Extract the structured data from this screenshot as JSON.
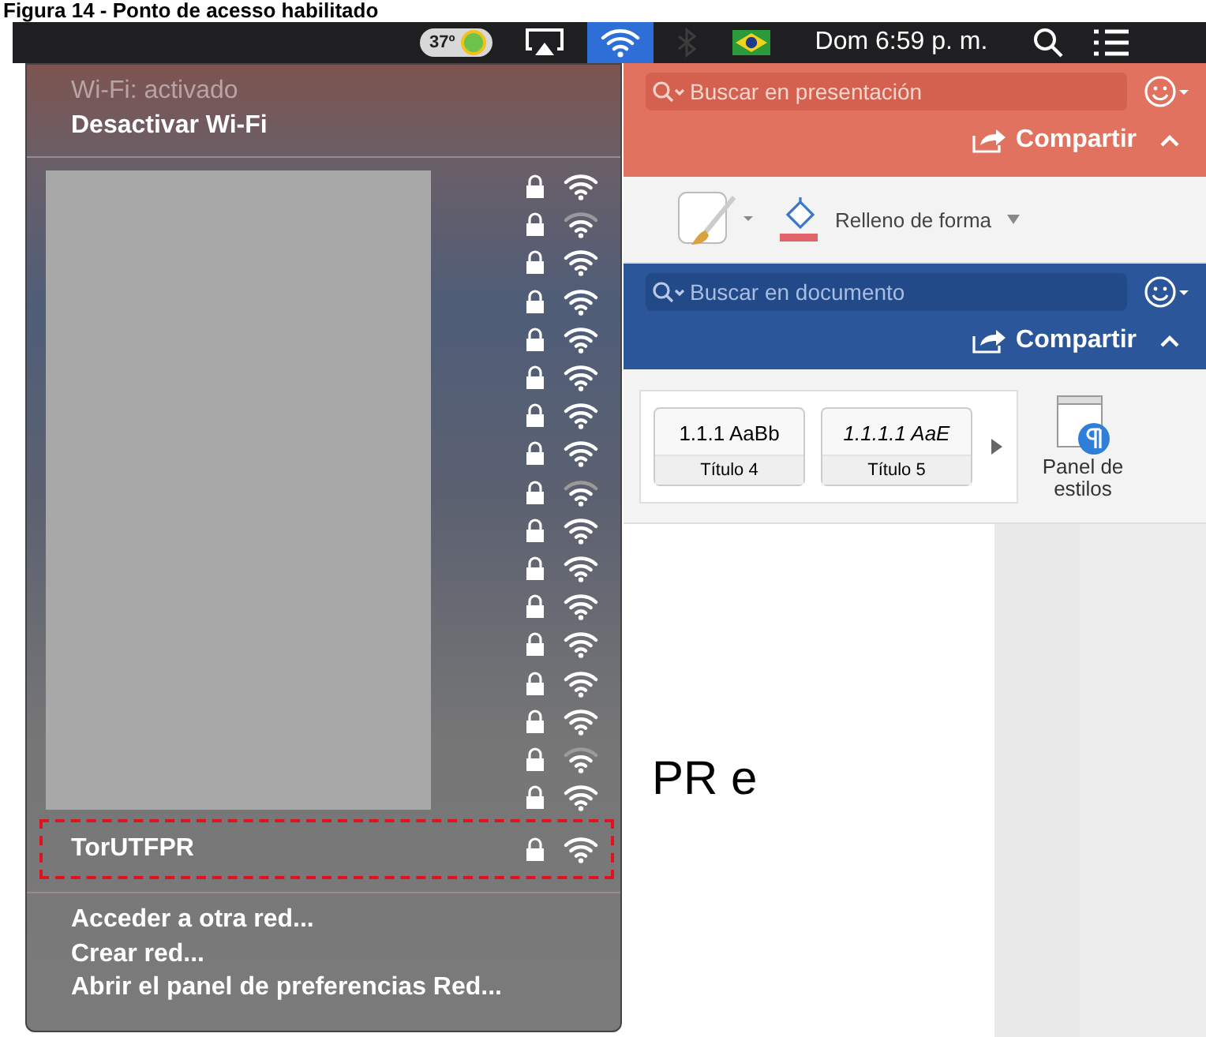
{
  "caption": "Figura 14 - Ponto de acesso habilitado",
  "menu_bar": {
    "temperature": "37º",
    "clock": "Dom 6:59 p. m.",
    "status_icons": [
      {
        "kind": "airplay",
        "selected": false,
        "disabled": false
      },
      {
        "kind": "wifi",
        "selected": true,
        "disabled": false
      },
      {
        "kind": "bluetooth",
        "selected": false,
        "disabled": true
      },
      {
        "kind": "flag",
        "selected": false,
        "disabled": false
      }
    ]
  },
  "presentation_app": {
    "search_placeholder": "Buscar en presentación",
    "share": "Compartir"
  },
  "shape_ribbon": {
    "shape_fill": "Relleno de forma"
  },
  "document_app": {
    "search_placeholder": "Buscar en documento",
    "share": "Compartir",
    "styles": [
      {
        "sample": "1.1.1  AaBb",
        "name": "Título 4",
        "italic": false
      },
      {
        "sample": "1.1.1.1  AaE",
        "name": "Título 5",
        "italic": true
      }
    ],
    "styles_pane": "Panel de estilos"
  },
  "document": {
    "text": "PR e"
  },
  "wifi_menu": {
    "status": "Wi-Fi: activado",
    "toggle": "Desactivar Wi-Fi",
    "networks": [
      {
        "locked": true,
        "weak": false
      },
      {
        "locked": true,
        "weak": true
      },
      {
        "locked": true,
        "weak": false
      },
      {
        "locked": true,
        "weak": false
      },
      {
        "locked": true,
        "weak": false
      },
      {
        "locked": true,
        "weak": false
      },
      {
        "locked": true,
        "weak": false
      },
      {
        "locked": true,
        "weak": false
      },
      {
        "locked": true,
        "weak": true
      },
      {
        "locked": true,
        "weak": false
      },
      {
        "locked": true,
        "weak": false
      },
      {
        "locked": true,
        "weak": false
      },
      {
        "locked": true,
        "weak": false
      },
      {
        "locked": true,
        "weak": false
      },
      {
        "locked": true,
        "weak": false
      },
      {
        "locked": true,
        "weak": true
      },
      {
        "locked": true,
        "weak": false
      }
    ],
    "current": {
      "name": "TorUTFPR",
      "locked": true,
      "weak": false,
      "highlighted": true
    },
    "actions": [
      "Acceder a otra red...",
      "Crear red...",
      "Abrir el panel de preferencias Red..."
    ]
  }
}
